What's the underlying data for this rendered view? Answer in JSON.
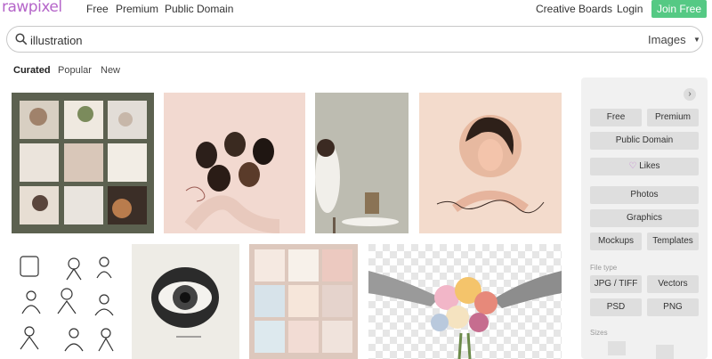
{
  "brand": {
    "logo_text": "rawpixel",
    "logo_color": "#b565c9",
    "accent": "#55c984"
  },
  "nav": {
    "free": "Free",
    "premium": "Premium",
    "public_domain": "Public Domain",
    "creative_boards": "Creative Boards",
    "login": "Login",
    "join": "Join Free"
  },
  "search": {
    "value": "illustration",
    "scope": "Images",
    "icon": "search-icon"
  },
  "tabs": [
    {
      "label": "Curated",
      "active": true
    },
    {
      "label": "Popular",
      "active": false
    },
    {
      "label": "New",
      "active": false
    }
  ],
  "gallery": [
    {
      "desc": "lifestyle-collage"
    },
    {
      "desc": "women-illustration"
    },
    {
      "desc": "woman-at-table"
    },
    {
      "desc": "woman-love"
    },
    {
      "desc": "doodle-people"
    },
    {
      "desc": "eye-engraving"
    },
    {
      "desc": "quote-cards"
    },
    {
      "desc": "hands-bouquet"
    }
  ],
  "sidebar": {
    "license": {
      "free": "Free",
      "premium": "Premium",
      "public_domain": "Public Domain"
    },
    "likes": "Likes",
    "types": {
      "photos": "Photos",
      "graphics": "Graphics",
      "mockups": "Mockups",
      "templates": "Templates"
    },
    "file_type_label": "File type",
    "file_types": {
      "jpg": "JPG / TIFF",
      "vectors": "Vectors",
      "psd": "PSD",
      "png": "PNG"
    },
    "sizes_label": "Sizes"
  }
}
